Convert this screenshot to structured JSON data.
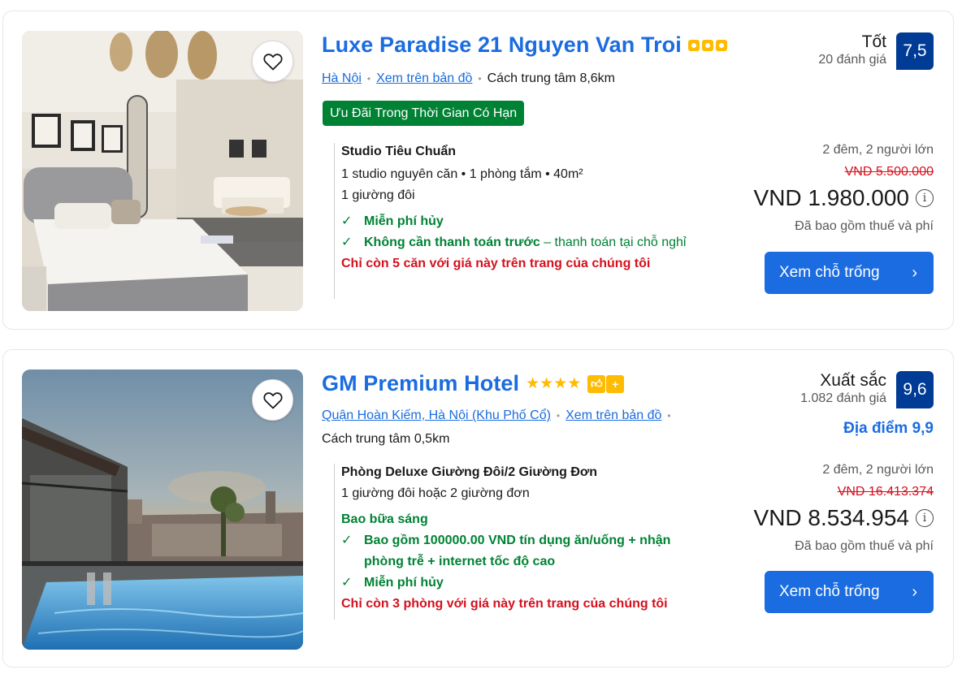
{
  "listings": [
    {
      "name": "Luxe Paradise 21 Nguyen Van Troi",
      "location_link": "Hà Nội",
      "map_link": "Xem trên bản đồ",
      "distance": "Cách trung tâm 8,6km",
      "deal_badge": "Ưu Đãi Trong Thời Gian Có Hạn",
      "room_name": "Studio Tiêu Chuẩn",
      "room_details": "1 studio nguyên căn • 1 phòng tắm • 40m²",
      "bed": "1 giường đôi",
      "perk_1": "Miễn phí hủy",
      "perk_2_bold": "Không cần thanh toán trước",
      "perk_2_rest": "– thanh toán tại chỗ nghỉ",
      "scarcity": "Chỉ còn 5 căn với giá này trên trang của chúng tôi",
      "rating_word": "Tốt",
      "review_count": "20 đánh giá",
      "score": "7,5",
      "stay": "2 đêm, 2 người lớn",
      "old_price": "VND 5.500.000",
      "price": "VND 1.980.000",
      "tax_note": "Đã bao gồm thuế và phí",
      "cta": "Xem chỗ trống",
      "rating_icon": "quality-dots-3"
    },
    {
      "name": "GM Premium Hotel",
      "location_link": "Quận Hoàn Kiếm, Hà Nội (Khu Phố Cổ)",
      "map_link": "Xem trên bản đồ",
      "distance": "Cách trung tâm 0,5km",
      "room_name": "Phòng Deluxe Giường Đôi/2 Giường Đơn",
      "bed": "1 giường đôi hoặc 2 giường đơn",
      "breakfast": "Bao bữa sáng",
      "perk_1": "Bao gồm 100000.00 VND tín dụng ăn/uống + nhận phòng trễ + internet tốc độ cao",
      "perk_2": "Miễn phí hủy",
      "scarcity": "Chỉ còn 3 phòng với giá này trên trang của chúng tôi",
      "rating_word": "Xuất sắc",
      "review_count": "1.082 đánh giá",
      "location_score": "Địa điểm 9,9",
      "score": "9,6",
      "stay": "2 đêm, 2 người lớn",
      "old_price": "VND 16.413.374",
      "price": "VND 8.534.954",
      "tax_note": "Đã bao gồm thuế và phí",
      "cta": "Xem chỗ trống",
      "stars": 4
    }
  ],
  "colors": {
    "link_blue": "#1a6ce0",
    "score_blue": "#003b95",
    "deal_green": "#008234",
    "scarcity_red": "#d4111e",
    "star_yellow": "#febb02"
  },
  "icons": {
    "favorite": "heart-outline-icon",
    "check": "checkmark-icon",
    "info": "info-circle-icon",
    "chevron": "chevron-right-icon"
  }
}
